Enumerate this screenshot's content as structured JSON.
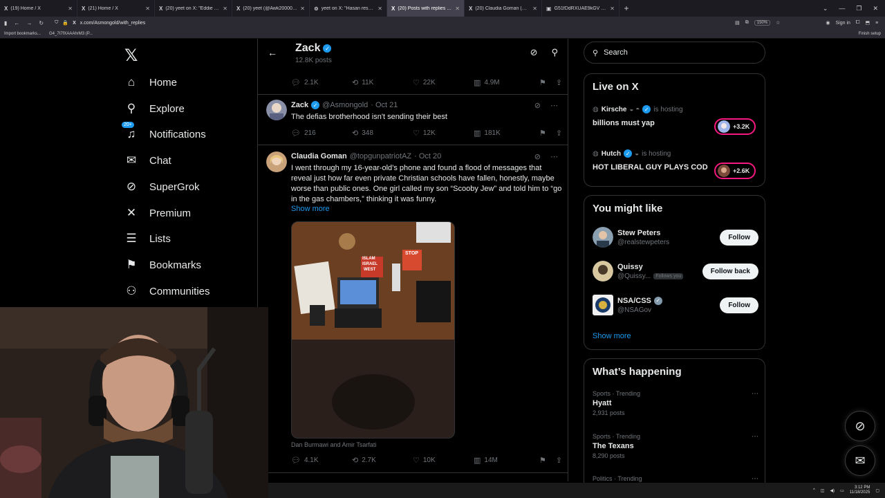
{
  "browser": {
    "tabs": [
      {
        "label": "(19) Home / X",
        "active": false
      },
      {
        "label": "(21) Home / X",
        "active": false
      },
      {
        "label": "(20) yeet on X: \"Eddie gives KP",
        "active": false
      },
      {
        "label": "(20) yeet (@Awk20000) / X",
        "active": false
      },
      {
        "label": "yeet on X: \"Hasan respond",
        "active": false
      },
      {
        "label": "(20) Posts with replies by Zack |",
        "active": true
      },
      {
        "label": "(20) Claudia Goman (@topgun",
        "active": false
      },
      {
        "label": "G51fDdRXUAE9kGV (JPEG Imag",
        "active": false
      }
    ],
    "url": "x.com/Asmongold/with_replies",
    "zoom": "150%",
    "sign_in": "Sign in",
    "bookmarks": [
      "Import bookmarks...",
      "G4_7t7fXAAAhrM3 (P..."
    ],
    "finish_setup": "Finish setup"
  },
  "sidebar": {
    "items": [
      {
        "label": "Home",
        "icon": "home-icon",
        "glyph": "⌂"
      },
      {
        "label": "Explore",
        "icon": "search-icon",
        "glyph": "⚲"
      },
      {
        "label": "Notifications",
        "icon": "bell-icon",
        "glyph": "🔔"
      },
      {
        "label": "Chat",
        "icon": "mail-icon",
        "glyph": "✉"
      },
      {
        "label": "SuperGrok",
        "icon": "grok-icon",
        "glyph": "⊘"
      },
      {
        "label": "Premium",
        "icon": "x-logo-icon",
        "glyph": "✕"
      },
      {
        "label": "Lists",
        "icon": "list-icon",
        "glyph": "☰"
      },
      {
        "label": "Bookmarks",
        "icon": "bookmark-icon",
        "glyph": "🔖"
      },
      {
        "label": "Communities",
        "icon": "people-icon",
        "glyph": "👥"
      }
    ],
    "notif_badge": "20+"
  },
  "profile_header": {
    "name": "Zack",
    "posts": "12.8K posts"
  },
  "tweets": [
    {
      "id": "partial",
      "stats": {
        "replies": "2.1K",
        "retweets": "11K",
        "likes": "22K",
        "views": "4.9M"
      }
    },
    {
      "id": "zack",
      "name": "Zack",
      "handle": "@Asmongold",
      "date": "· Oct 21",
      "text": "The defias brotherhood isn't sending their best",
      "stats": {
        "replies": "216",
        "retweets": "348",
        "likes": "12K",
        "views": "181K"
      }
    },
    {
      "id": "claudia",
      "name": "Claudia Goman",
      "handle": "@topgunpatriotAZ",
      "date": "· Oct 20",
      "text": "I went through my 16-year-old’s phone and found a flood of messages that reveal just how far even private Christian schools have fallen, honestly, maybe worse than public ones. One girl called my son “Scooby Jew” and told him to “go in the gas chambers,” thinking it was funny.",
      "show_more": "Show more",
      "image_caption": "Dan Burmawi and Amir Tsarfati",
      "book_labels": [
        "ISLAM",
        "ISRAEL",
        "WEST",
        "STOP"
      ],
      "stats": {
        "replies": "4.1K",
        "retweets": "2.7K",
        "likes": "10K",
        "views": "14M"
      }
    }
  ],
  "search": {
    "placeholder": "Search"
  },
  "live": {
    "title": "Live on X",
    "hosting_label": "is hosting",
    "items": [
      {
        "host": "Kirsche",
        "title": "billions must yap",
        "count": "+3.2K"
      },
      {
        "host": "Hutch",
        "title": "HOT LIBERAL GUY PLAYS COD",
        "count": "+2.6K"
      }
    ]
  },
  "suggestions": {
    "title": "You might like",
    "items": [
      {
        "name": "Stew Peters",
        "handle": "@realstewpeters",
        "button": "Follow",
        "follows_you": ""
      },
      {
        "name": "Quissy",
        "handle": "@Quissy...",
        "button": "Follow back",
        "follows_you": "Follows you"
      },
      {
        "name": "NSA/CSS",
        "handle": "@NSAGov",
        "button": "Follow",
        "follows_you": ""
      }
    ],
    "show_more": "Show more"
  },
  "trending": {
    "title": "What’s happening",
    "items": [
      {
        "meta": "Sports · Trending",
        "name": "Hyatt",
        "count": "2,931 posts"
      },
      {
        "meta": "Sports · Trending",
        "name": "The Texans",
        "count": "8,290 posts"
      },
      {
        "meta": "Politics · Trending",
        "name": "",
        "count": ""
      }
    ]
  },
  "taskbar": {
    "time": "3:12 PM",
    "date": "11/18/2025"
  },
  "colors": {
    "accent": "#1d9bf0",
    "live_ring": "#f91880",
    "background": "#000000"
  }
}
